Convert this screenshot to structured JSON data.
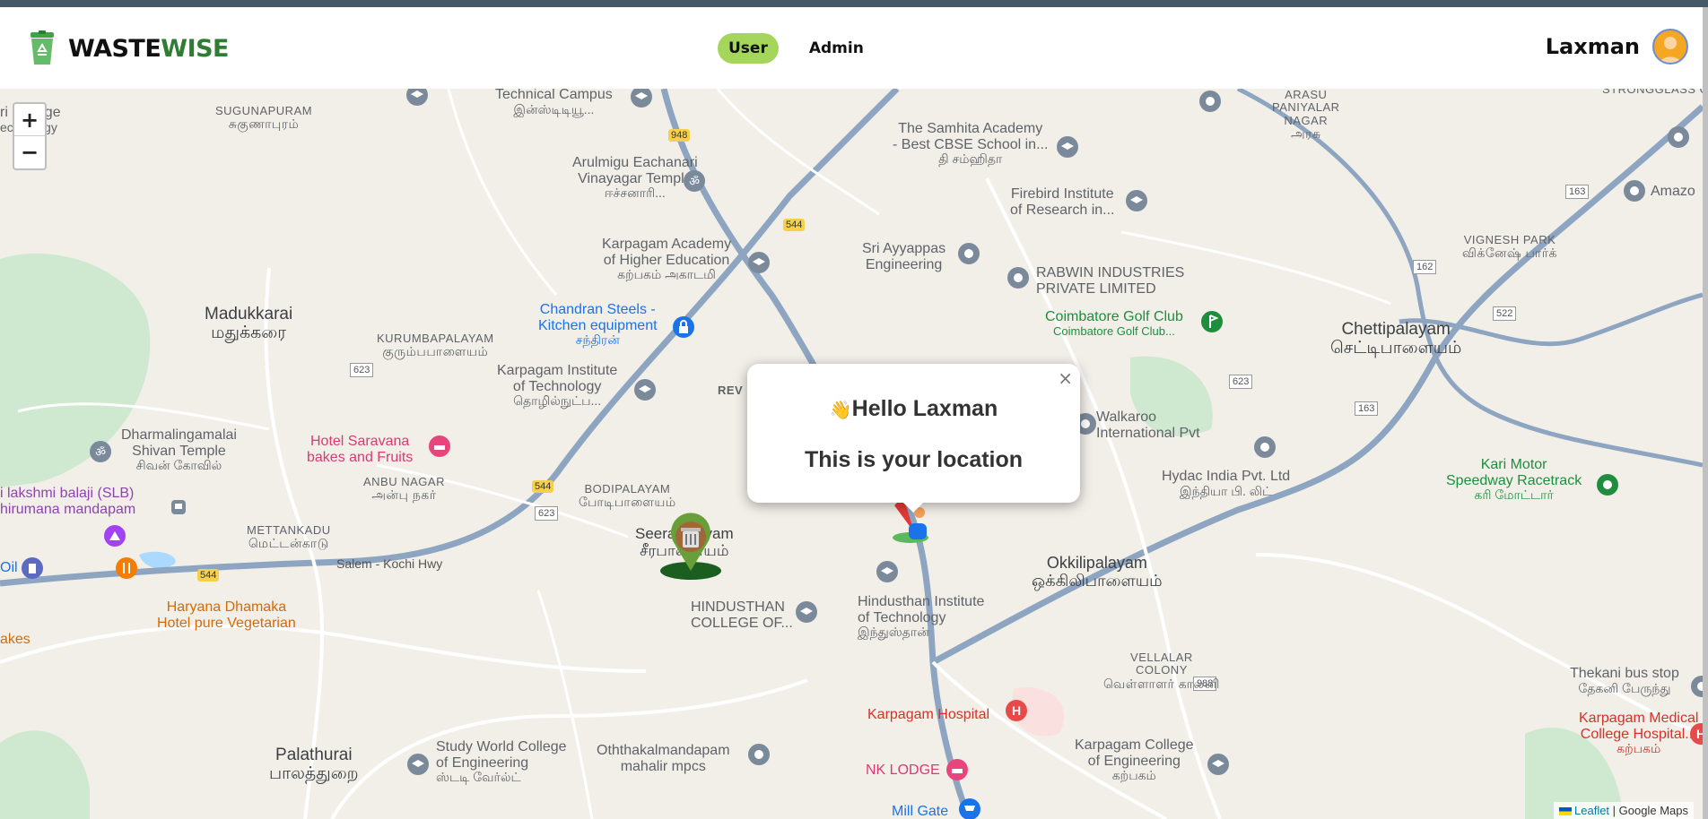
{
  "app": {
    "logo_word1": "WASTE",
    "logo_word2": "WISE",
    "brand_color": "#2e7d32",
    "active_nav_color": "#a5d65c"
  },
  "nav": {
    "user_label": "User",
    "admin_label": "Admin"
  },
  "account": {
    "name": "Laxman",
    "avatar_icon": "avatar-icon"
  },
  "map": {
    "zoom_in": "+",
    "zoom_out": "−",
    "attribution_leaflet": "Leaflet",
    "attribution_sep": " | ",
    "attribution_source": "Google Maps",
    "labels": {
      "technical_campus": "Technical Campus",
      "technical_campus_ta": "இன்ஸ்டிடியூ...",
      "sugunapuram": "SUGUNAPURAM",
      "sugunapuram_ta": "சுகுணாபுரம்",
      "college_partial": "ri College",
      "college_partial2": "echnology",
      "arulmigu": "Arulmigu Eachanari",
      "arulmigu2": "Vinayagar Temple",
      "arulmigu_ta": "ஈச்சனாரி...",
      "samhita": "The Samhita Academy",
      "samhita2": "- Best CBSE School in...",
      "samhita_ta": "தி சம்ஹிதா",
      "arasu": "ARASU",
      "arasu2": "PANIYALAR",
      "arasu3": "NAGAR",
      "arasu_ta": "அரசு",
      "strongglass": "STRONGGLASS COI",
      "firebird": "Firebird Institute",
      "firebird2": "of Research in...",
      "karpagam_academy": "Karpagam Academy",
      "karpagam_academy2": "of Higher Education",
      "karpagam_academy_ta": "கற்பகம் அகாடமி",
      "ayyappas": "Sri Ayyappas",
      "ayyappas2": "Engineering",
      "rabwin": "RABWIN INDUSTRIES",
      "rabwin2": "PRIVATE LIMITED",
      "vignesh": "VIGNESH PARK",
      "vignesh_ta": "விக்னேஷ் பார்க்",
      "amazon": "Amazo",
      "madukkarai": "Madukkarai",
      "madukkarai_ta": "மதுக்கரை",
      "kurumba": "KURUMBAPALAYAM",
      "kurumba_ta": "குரும்பபாளையம்",
      "chandran": "Chandran Steels -",
      "chandran2": "Kitchen equipment",
      "chandran_ta": "சந்திரன்",
      "golf": "Coimbatore Golf Club",
      "golf_ta": "Coimbatore Golf Club...",
      "chettipalayam": "Chettipalayam",
      "chettipalayam_ta": "செட்டிபாளையம்",
      "karpagam_inst": "Karpagam Institute",
      "karpagam_inst2": "of Technology",
      "karpagam_inst_ta": "தொழில்நுட்ப...",
      "walkaroo": "Walkaroo",
      "walkaroo2": "International Pvt",
      "dharmalinga": "Dharmalingamalai",
      "dharmalinga2": "Shivan Temple",
      "dharmalinga_ta": "சிவன் கோவில்",
      "saravana": "Hotel Saravana",
      "saravana2": "bakes and Fruits",
      "hydac": "Hydac India Pvt. Ltd",
      "hydac_ta": "இந்தியா பி. லிட்",
      "kari": "Kari Motor",
      "kari2": "Speedway Racetrack",
      "kari_ta": "கரி மோட்டார்",
      "lakshmi": "i lakshmi balaji (SLB)",
      "lakshmi2": "hirumana mandapam",
      "anbu": "ANBU NAGAR",
      "anbu_ta": "அன்பு நகர்",
      "bodipalayam": "BODIPALAYAM",
      "bodipalayam_ta": "போடிபாளையம்",
      "mettankadu": "METTANKADU",
      "mettankadu_ta": "மெட்டன்காடு",
      "seerapalayam": "Seerapalayam",
      "seerapalayam_ta": "சீரபாளையம்",
      "okkili": "Okkilipalayam",
      "okkili_ta": "ஒக்கிலிபாளையம்",
      "salem": "Salem - Kochi Hwy",
      "haryana": "Haryana Dhamaka",
      "haryana2": "Hotel pure Vegetarian",
      "oil": "Oil",
      "akes": "akes",
      "hindusthan_college": "HINDUSTHAN",
      "hindusthan_college2": "COLLEGE OF...",
      "hindusthan_inst": "Hindusthan Institute",
      "hindusthan_inst2": "of Technology",
      "hindusthan_inst_ta": "இந்துஸ்தான்",
      "vellalar": "VELLALAR",
      "vellalar2": "COLONY",
      "vellalar_ta": "வெள்ளாளர் காலனி",
      "thekani": "Thekani bus stop",
      "thekani_ta": "தேகனி பேருந்து",
      "karpagam_hospital": "Karpagam Hospital",
      "karpagam_medical": "Karpagam Medical",
      "karpagam_medical2": "College Hospital...",
      "karpagam_medical_ta": "கற்பகம்",
      "palathurai": "Palathurai",
      "palathurai_ta": "பாலத்துறை",
      "study_world": "Study World College",
      "study_world2": "of Engineering",
      "study_world_ta": "ஸ்டடி வேர்ல்ட்",
      "oththakal": "Oththakalmandapam",
      "oththakal2": "mahalir mpcs",
      "karpagam_college": "Karpagam College",
      "karpagam_college2": "of Engineering",
      "karpagam_college_ta": "கற்பகம்",
      "nk_lodge": "NK LODGE",
      "mill_gate": "Mill Gate",
      "road_948": "948",
      "road_544": "544",
      "road_623": "623",
      "road_162": "162",
      "road_163": "163",
      "road_522": "522",
      "road_988": "988",
      "rev": "REV"
    }
  },
  "popup": {
    "greeting_emoji": "👋",
    "greeting": "Hello Laxman",
    "message": "This is your location",
    "close": "×"
  }
}
